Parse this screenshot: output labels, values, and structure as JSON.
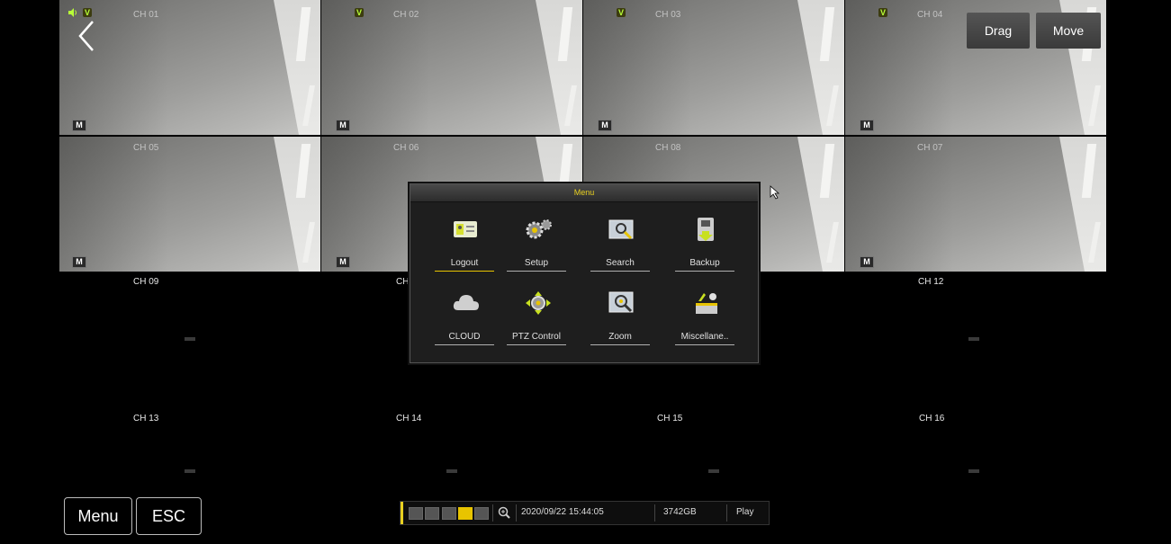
{
  "top_buttons": {
    "drag_label": "Drag",
    "move_label": "Move"
  },
  "bottom_buttons": {
    "menu_label": "Menu",
    "esc_label": "ESC"
  },
  "channels": {
    "ch01": "CH 01",
    "ch02": "CH 02",
    "ch03": "CH 03",
    "ch04": "CH 04",
    "ch05": "CH 05",
    "ch06": "CH 06",
    "ch08": "CH 08",
    "ch07": "CH 07",
    "ch09": "CH 09",
    "ch10": "CH",
    "ch12": "CH 12",
    "ch13": "CH 13",
    "ch14": "CH 14",
    "ch15": "CH 15",
    "ch16": "CH 16"
  },
  "badges": {
    "motion": "M",
    "video": "V"
  },
  "menu": {
    "title": "Menu",
    "items": [
      {
        "label": "Logout",
        "icon": "logout-icon"
      },
      {
        "label": "Setup",
        "icon": "setup-icon"
      },
      {
        "label": "Search",
        "icon": "search-icon"
      },
      {
        "label": "Backup",
        "icon": "backup-icon"
      },
      {
        "label": "CLOUD",
        "icon": "cloud-icon"
      },
      {
        "label": "PTZ Control",
        "icon": "ptz-icon"
      },
      {
        "label": "Zoom",
        "icon": "zoom-icon"
      },
      {
        "label": "Miscellane..",
        "icon": "misc-icon"
      }
    ]
  },
  "status": {
    "datetime": "2020/09/22 15:44:05",
    "storage": "3742GB",
    "play_label": "Play"
  },
  "colors": {
    "accent": "#e8d020",
    "badge_green": "#b8ff38",
    "background": "#000000"
  }
}
